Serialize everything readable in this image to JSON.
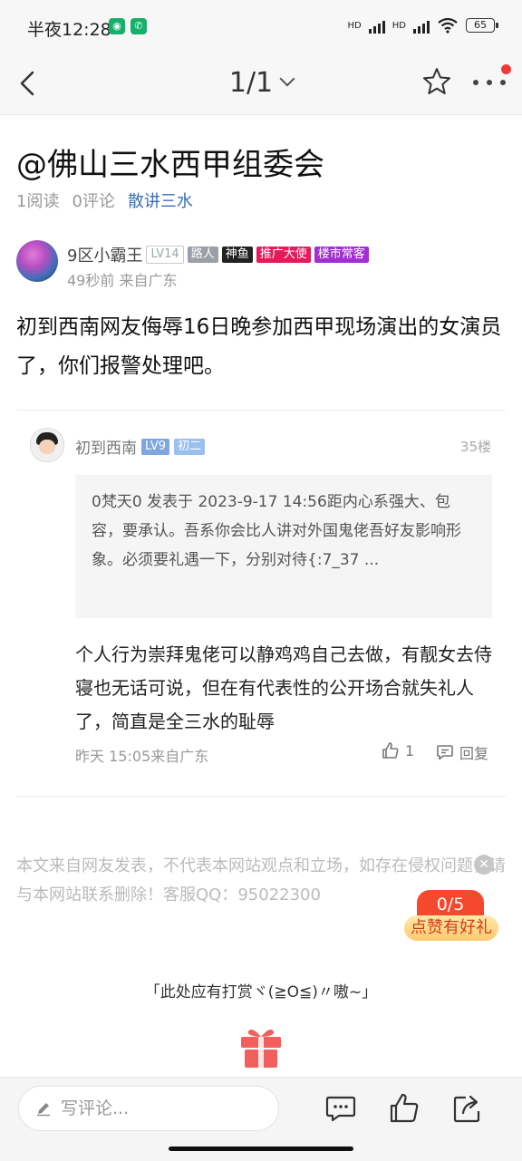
{
  "status": {
    "time": "半夜12:28",
    "battery": "65",
    "net1": "HD",
    "net2": "HD"
  },
  "nav": {
    "page_indicator": "1/1"
  },
  "post": {
    "title": "@佛山三水西甲组委会",
    "reads": "1阅读",
    "comments": "0评论",
    "category": "散讲三水",
    "author": {
      "name": "9区小霸王",
      "tags": [
        "LV14",
        "路人",
        "神鱼",
        "推广大使",
        "楼市常客"
      ],
      "meta": "49秒前  来自广东"
    },
    "content": "初到西南网友侮辱16日晚参加西甲现场演出的女演员了，你们报警处理吧。"
  },
  "comment": {
    "name": "初到西南",
    "tags": [
      "LV9",
      "初二"
    ],
    "floor": "35楼",
    "quote": "0梵天0 发表于 2023-9-17 14:56距内心系强大、包容，要承认。吾系你会比人讲对外国鬼佬吾好友影响形象。必须要礼遇一下，分别对待{:7_37 ...",
    "text": "个人行为崇拜鬼佬可以静鸡鸡自己去做，有靓女去侍寝也无话可说，但在有代表性的公开场合就失礼人了，简直是全三水的耻辱",
    "time": "昨天 15:05来自广东",
    "likes": "1",
    "reply_label": "回复"
  },
  "disclaimer": "本文来自网友发表，不代表本网站观点和立场，如存在侵权问题，请与本网站联系删除！客服QQ：95022300",
  "gift_badge": {
    "count": "0/5",
    "label": "点赞有好礼"
  },
  "reward_text": "「此处应有打赏ヾ(≧O≦)〃嗷~」",
  "bottom": {
    "comment_placeholder": "写评论..."
  },
  "colors": {
    "accent_blue": "#3a6fb6",
    "badge_red": "#f5492d",
    "gift_red": "#f25f5c"
  }
}
